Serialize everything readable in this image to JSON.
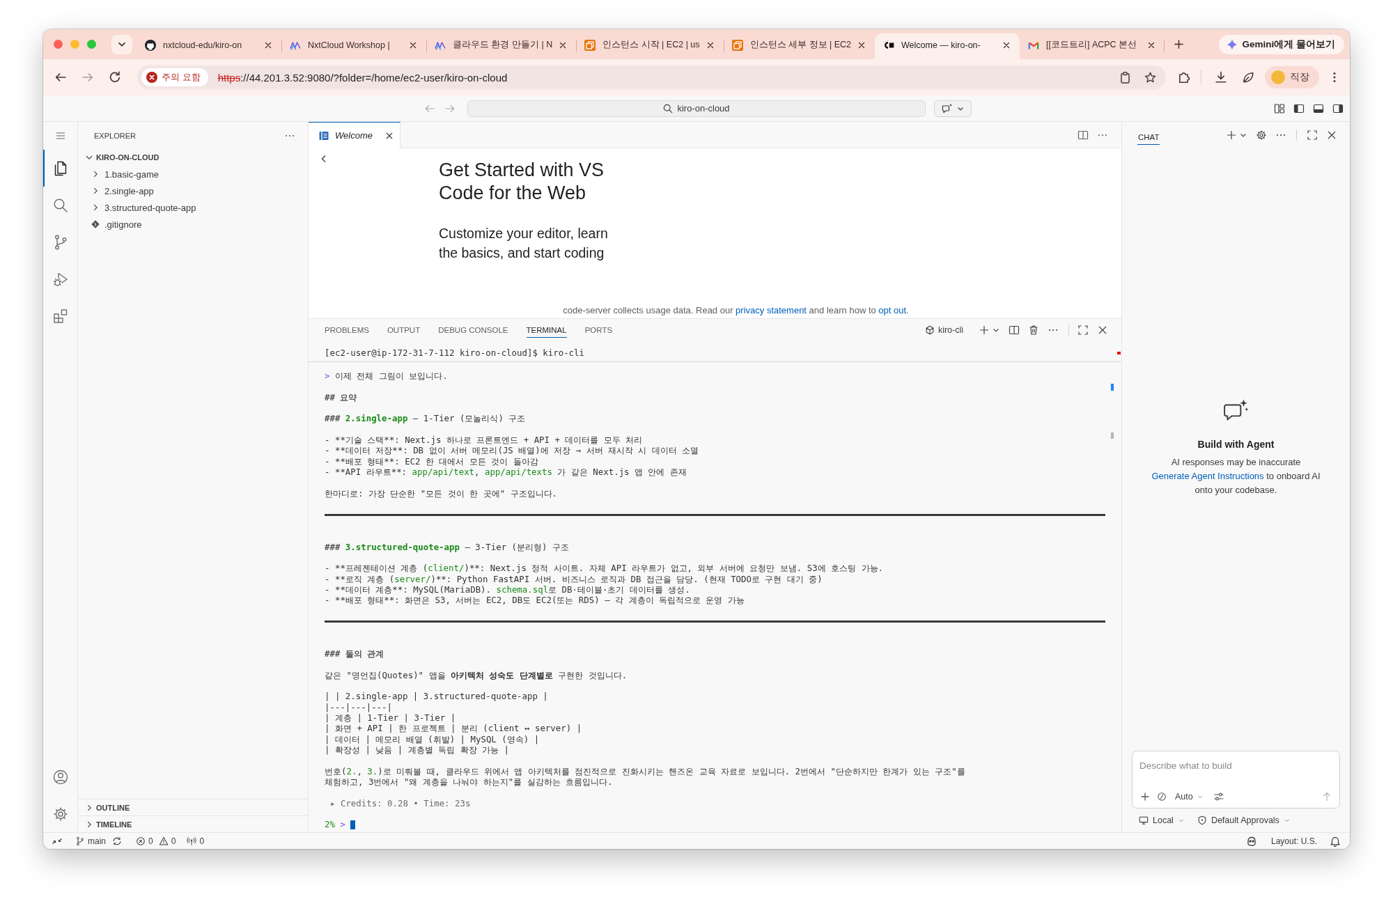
{
  "browser": {
    "tabs": [
      {
        "kind": "github",
        "title": "nxtcloud-edu/kiro-on",
        "selected": false
      },
      {
        "kind": "nxtcloud",
        "title": "NxtCloud Workshop |",
        "selected": false
      },
      {
        "kind": "nxtcloud",
        "title": "클라우드 환경 만들기 | N",
        "selected": false
      },
      {
        "kind": "aws",
        "title": "인스턴스 시작 | EC2 | us",
        "selected": false
      },
      {
        "kind": "aws",
        "title": "인스턴스 세부 정보 | EC2",
        "selected": false
      },
      {
        "kind": "codeserver",
        "title": "Welcome — kiro-on-",
        "selected": true
      },
      {
        "kind": "gmail",
        "title": "[[코드트리] ACPC 본선",
        "selected": false
      }
    ],
    "gemini": "Gemini에게 물어보기",
    "address": {
      "badge": "주의 요함",
      "scheme": "https",
      "rest": "://44.201.3.52:9080/?folder=/home/ec2-user/kiro-on-cloud",
      "secure": false
    },
    "profile": "직장"
  },
  "title_bar": {
    "search": "kiro-on-cloud"
  },
  "activity_bar": [
    {
      "kind": "explorer",
      "selected": true
    },
    {
      "kind": "search",
      "selected": false
    },
    {
      "kind": "source-control",
      "selected": false
    },
    {
      "kind": "run-debug",
      "selected": false
    },
    {
      "kind": "extensions",
      "selected": false
    }
  ],
  "sidebar": {
    "title": "EXPLORER",
    "tree": [
      {
        "label": "KIRO-ON-CLOUD",
        "kind": "root",
        "expanded": true,
        "children": [
          {
            "label": "1.basic-game",
            "kind": "folder",
            "expanded": false
          },
          {
            "label": "2.single-app",
            "kind": "folder",
            "expanded": false
          },
          {
            "label": "3.structured-quote-app",
            "kind": "folder",
            "expanded": false
          },
          {
            "label": ".gitignore",
            "kind": "git-file"
          }
        ]
      }
    ],
    "sections": [
      {
        "label": "OUTLINE",
        "expanded": false
      },
      {
        "label": "TIMELINE",
        "expanded": false
      }
    ]
  },
  "editor": {
    "tabs": [
      {
        "label": "Welcome",
        "selected": true,
        "preview": true
      }
    ],
    "welcome": {
      "title": "Get Started with VS Code for the Web",
      "subtitle": "Customize your editor, learn the basics, and start coding",
      "notice": [
        {
          "kind": "text",
          "text": "code-server collects usage data. Read our "
        },
        {
          "kind": "link",
          "text": "privacy statement"
        },
        {
          "kind": "text",
          "text": " and learn how to "
        },
        {
          "kind": "link",
          "text": "opt out"
        },
        {
          "kind": "text",
          "text": "."
        }
      ]
    }
  },
  "panel": {
    "tabs": [
      {
        "label": "PROBLEMS",
        "selected": false
      },
      {
        "label": "OUTPUT",
        "selected": false
      },
      {
        "label": "DEBUG CONSOLE",
        "selected": false
      },
      {
        "label": "TERMINAL",
        "selected": true
      },
      {
        "label": "PORTS",
        "selected": false
      }
    ],
    "terminal": {
      "name": "kiro-cli",
      "sticky": "[ec2-user@ip-172-31-7-112 kiro-on-cloud]$ kiro-cli",
      "blocks": [
        {
          "kind": "text",
          "lines": [
            [
              {
                "kind": "accent",
                "text": ">"
              },
              {
                "kind": "plain",
                "text": " 이제 전체 그림이 보입니다."
              }
            ]
          ]
        },
        {
          "kind": "text",
          "lines": [
            [
              {
                "kind": "heading",
                "text": "## 요약"
              }
            ]
          ]
        },
        {
          "kind": "text",
          "lines": [
            [
              {
                "kind": "heading",
                "text": "### "
              },
              {
                "kind": "title",
                "text": "2.single-app"
              },
              {
                "kind": "plain",
                "text": " — 1-Tier (모놀리식) 구조"
              }
            ]
          ]
        },
        {
          "kind": "text",
          "lines": [
            [
              {
                "kind": "plain",
                "text": "- **기술 스택**: Next.js 하나로 프론트엔드 + API + 데이터를 모두 처리"
              }
            ],
            [
              {
                "kind": "plain",
                "text": "- **데이터 저장**: DB 없이 서버 메모리(JS 배열)에 저장 → 서버 재시작 시 데이터 소멸"
              }
            ],
            [
              {
                "kind": "plain",
                "text": "- **배포 형태**: EC2 한 대에서 모든 것이 돌아감"
              }
            ],
            [
              {
                "kind": "plain",
                "text": "- **API 라우트**: "
              },
              {
                "kind": "code",
                "text": "app/api/text"
              },
              {
                "kind": "plain",
                "text": ", "
              },
              {
                "kind": "code",
                "text": "app/api/texts"
              },
              {
                "kind": "plain",
                "text": " 가 같은 Next.js 앱 안에 존재"
              }
            ]
          ]
        },
        {
          "kind": "text",
          "lines": [
            [
              {
                "kind": "plain",
                "text": "한마디로: 가장 단순한 \"모든 것이 한 곳에\" 구조입니다."
              }
            ]
          ]
        },
        {
          "kind": "rule"
        },
        {
          "kind": "text",
          "lines": [
            [
              {
                "kind": "heading",
                "text": "### "
              },
              {
                "kind": "title",
                "text": "3.structured-quote-app"
              },
              {
                "kind": "plain",
                "text": " — 3-Tier (분리형) 구조"
              }
            ]
          ]
        },
        {
          "kind": "text",
          "lines": [
            [
              {
                "kind": "plain",
                "text": "- **프레젠테이션 계층 ("
              },
              {
                "kind": "code",
                "text": "client/"
              },
              {
                "kind": "plain",
                "text": ")**: Next.js 정적 사이트. 자체 API 라우트가 없고, 외부 서버에 요청만 보냄. S3에 호스팅 가능."
              }
            ],
            [
              {
                "kind": "plain",
                "text": "- **로직 계층 ("
              },
              {
                "kind": "code",
                "text": "server/"
              },
              {
                "kind": "plain",
                "text": ")**: Python FastAPI 서버. 비즈니스 로직과 DB 접근을 담당. (현재 TODO로 구현 대기 중)"
              }
            ],
            [
              {
                "kind": "plain",
                "text": "- **데이터 계층**: MySQL(MariaDB). "
              },
              {
                "kind": "code",
                "text": "schema.sql"
              },
              {
                "kind": "plain",
                "text": "로 DB·테이블·초기 데이터를 생성."
              }
            ],
            [
              {
                "kind": "plain",
                "text": "- **배포 형태**: 화면은 S3, 서버는 EC2, DB도 EC2(또는 RDS) — 각 계층이 독립적으로 운영 가능"
              }
            ]
          ]
        },
        {
          "kind": "rule"
        },
        {
          "kind": "text",
          "lines": [
            [
              {
                "kind": "heading",
                "text": "### 둘의 관계"
              }
            ]
          ]
        },
        {
          "kind": "text",
          "lines": [
            [
              {
                "kind": "plain",
                "text": "같은 \"명언집(Quotes)\" 앱을 "
              },
              {
                "kind": "bold",
                "text": "아키텍처 성숙도 단계별로"
              },
              {
                "kind": "plain",
                "text": " 구현한 것입니다."
              }
            ]
          ]
        },
        {
          "kind": "text",
          "lines": [
            [
              {
                "kind": "plain",
                "text": "| | 2.single-app | 3.structured-quote-app |"
              }
            ],
            [
              {
                "kind": "plain",
                "text": "|---|---|---|"
              }
            ],
            [
              {
                "kind": "plain",
                "text": "| 계층 | 1-Tier | 3-Tier |"
              }
            ],
            [
              {
                "kind": "plain",
                "text": "| 화면 + API | 한 프로젝트 | 분리 (client ↔ server) |"
              }
            ],
            [
              {
                "kind": "plain",
                "text": "| 데이터 | 메모리 배열 (휘발) | MySQL (영속) |"
              }
            ],
            [
              {
                "kind": "plain",
                "text": "| 확장성 | 낮음 | 계층별 독립 확장 가능 |"
              }
            ]
          ]
        },
        {
          "kind": "text",
          "lines": [
            [
              {
                "kind": "plain",
                "text": "번호("
              },
              {
                "kind": "code",
                "text": "2."
              },
              {
                "kind": "plain",
                "text": ", "
              },
              {
                "kind": "code",
                "text": "3."
              },
              {
                "kind": "plain",
                "text": ")로 미뤄볼 때, 클라우드 위에서 앱 아키텍처를 점진적으로 진화시키는 핸즈온 교육 자료로 보입니다. 2번에서 \"단순하지만 한계가 있는 구조\"를"
              }
            ],
            [
              {
                "kind": "plain",
                "text": "체험하고, 3번에서 \"왜 계층을 나눠야 하는지\"를 실감하는 흐름입니다."
              }
            ]
          ]
        },
        {
          "kind": "text",
          "lines": [
            [
              {
                "kind": "muted",
                "text": "▸ Credits: 0.28 • Time: 23s"
              }
            ]
          ]
        },
        {
          "kind": "prompt",
          "lines": [
            [
              {
                "kind": "code",
                "text": "2%"
              },
              {
                "kind": "accent",
                "text": " >"
              }
            ]
          ]
        }
      ]
    }
  },
  "chat": {
    "tab": {
      "label": "CHAT",
      "selected": true
    },
    "heading": "Build with Agent",
    "disclaimer": "AI responses may be inaccurate",
    "hint": [
      {
        "kind": "link",
        "text": "Generate Agent Instructions"
      },
      {
        "kind": "text",
        "text": " to onboard AI onto your codebase."
      }
    ],
    "input": {
      "placeholder": "Describe what to build"
    },
    "mode": "Auto",
    "target": "Local",
    "approvals": "Default Approvals"
  },
  "status_bar": {
    "branch": "main",
    "errors": "0",
    "warnings": "0",
    "ports": "0",
    "layout": "Layout: U.S."
  }
}
